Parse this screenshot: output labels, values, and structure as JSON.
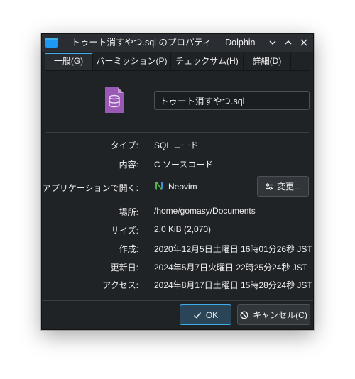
{
  "window": {
    "title": "トゥート消すやつ.sql のプロパティ — Dolphin",
    "app_icon": "folder-icon",
    "controls": {
      "menu_icon": "chevron-down-icon",
      "minimize_icon": "chevron-up-icon",
      "close_icon": "close-icon"
    }
  },
  "tabs": [
    {
      "label": "一般(G)",
      "active": true
    },
    {
      "label": "パーミッション(P)",
      "active": false
    },
    {
      "label": "チェックサム(H)",
      "active": false
    },
    {
      "label": "詳細(D)",
      "active": false
    }
  ],
  "general": {
    "file_icon": "database-file-icon",
    "filename": "トゥート消すやつ.sql",
    "rows": {
      "type": {
        "label": "タイプ:",
        "value": "SQL コード"
      },
      "contents": {
        "label": "内容:",
        "value": "C ソースコード"
      },
      "open_with": {
        "label": "アプリケーションで開く:",
        "value": "Neovim",
        "button": "変更...",
        "button_icon": "configure-icon"
      },
      "location": {
        "label": "場所:",
        "value": "/home/gomasy/Documents"
      },
      "size": {
        "label": "サイズ:",
        "value": "2.0 KiB (2,070)"
      },
      "created": {
        "label": "作成:",
        "value": "2020年12月5日土曜日 16時01分26秒 JST"
      },
      "modified": {
        "label": "更新日:",
        "value": "2024年5月7日火曜日 22時25分24秒 JST"
      },
      "accessed": {
        "label": "アクセス:",
        "value": "2024年8月17日土曜日 15時28分24秒 JST"
      }
    }
  },
  "buttons": {
    "ok": "OK",
    "cancel": "キャンセル(C)"
  },
  "colors": {
    "accent": "#3daee9",
    "background": "#202326",
    "file_icon": "#9b59b6"
  }
}
